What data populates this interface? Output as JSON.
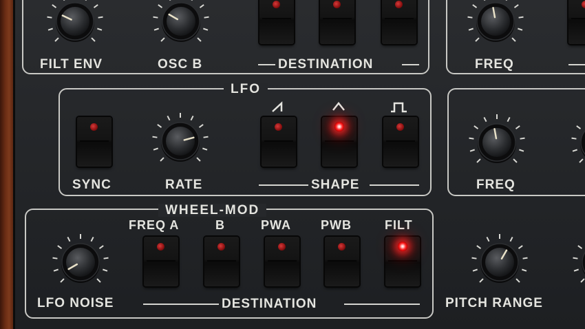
{
  "top_row": {
    "filt_env": "FILT ENV",
    "osc_b": "OSC B",
    "destination": "DESTINATION",
    "freq": "FREQ"
  },
  "lfo": {
    "title": "LFO",
    "sync": "SYNC",
    "rate": "RATE",
    "shape": "SHAPE",
    "shape_sawtooth_icon": "sawtooth-wave-icon",
    "shape_triangle_icon": "triangle-wave-icon",
    "shape_square_icon": "square-wave-icon",
    "shape_buttons_lit": [
      false,
      true,
      false
    ],
    "sync_lit": false
  },
  "right_mid": {
    "freq": "FREQ"
  },
  "wheel_mod": {
    "title": "WHEEL-MOD",
    "lfo_noise": "LFO NOISE",
    "freq_a": "FREQ A",
    "b": "B",
    "pwa": "PWA",
    "pwb": "PWB",
    "filt": "FILT",
    "destination": "DESTINATION",
    "lit": [
      false,
      false,
      false,
      false,
      true
    ]
  },
  "pitch_range": "PITCH RANGE",
  "accent_colors": {
    "led_on": "#ff2a2a",
    "led_off": "#8a1010",
    "panel_line": "#c9c9c5"
  }
}
